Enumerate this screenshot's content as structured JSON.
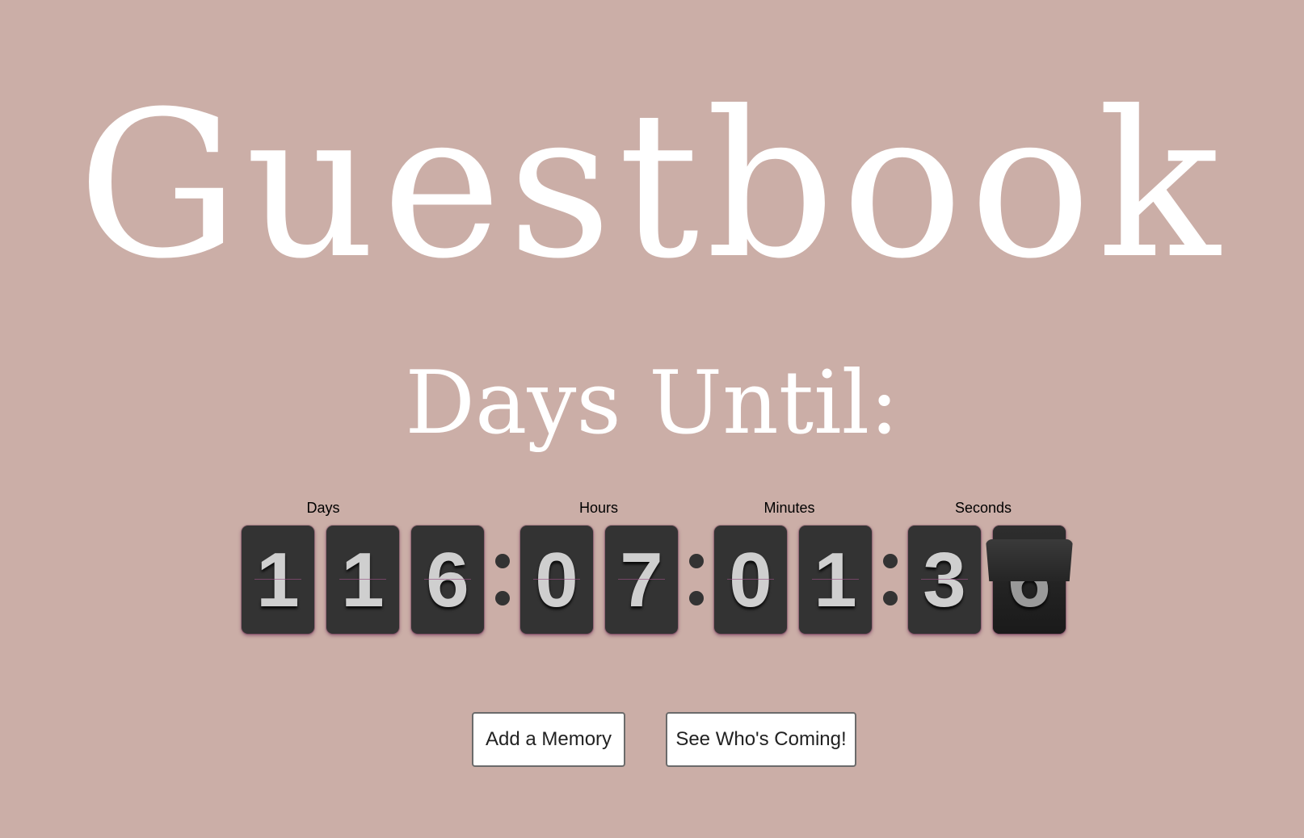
{
  "page": {
    "background_color": "#cbaea7",
    "title": "Guestbook",
    "subtitle": "Days Until:"
  },
  "countdown": {
    "labels": {
      "days": "Days",
      "hours": "Hours",
      "minutes": "Minutes",
      "seconds": "Seconds"
    },
    "days": [
      "1",
      "1",
      "6"
    ],
    "hours": [
      "0",
      "7"
    ],
    "minutes": [
      "0",
      "1"
    ],
    "seconds": [
      "3",
      "6"
    ],
    "card_color": "#333333",
    "digit_color": "#cfcfcf"
  },
  "buttons": {
    "add_memory": "Add a Memory",
    "see_whos_coming": "See Who's Coming!"
  }
}
